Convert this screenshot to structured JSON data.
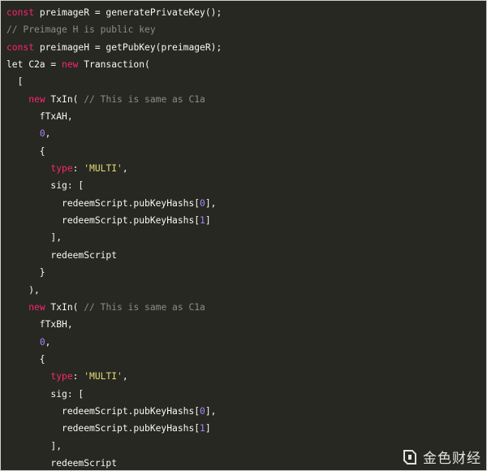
{
  "code": {
    "lines": [
      [
        {
          "t": "keyword",
          "v": "const"
        },
        {
          "t": "plain",
          "v": " preimageR = generatePrivateKey();"
        }
      ],
      [
        {
          "t": "comment",
          "v": "// Preimage H is public key"
        }
      ],
      [
        {
          "t": "keyword",
          "v": "const"
        },
        {
          "t": "plain",
          "v": " preimageH = getPubKey(preimageR);"
        }
      ],
      [
        {
          "t": "plain",
          "v": "let C2a = "
        },
        {
          "t": "keyword",
          "v": "new"
        },
        {
          "t": "plain",
          "v": " Transaction("
        }
      ],
      [
        {
          "t": "plain",
          "v": "  ["
        }
      ],
      [
        {
          "t": "plain",
          "v": "    "
        },
        {
          "t": "keyword",
          "v": "new"
        },
        {
          "t": "plain",
          "v": " TxIn( "
        },
        {
          "t": "comment",
          "v": "// This is same as C1a"
        }
      ],
      [
        {
          "t": "plain",
          "v": "      fTxAH,"
        }
      ],
      [
        {
          "t": "plain",
          "v": "      "
        },
        {
          "t": "number",
          "v": "0"
        },
        {
          "t": "plain",
          "v": ","
        }
      ],
      [
        {
          "t": "plain",
          "v": "      {"
        }
      ],
      [
        {
          "t": "plain",
          "v": "        "
        },
        {
          "t": "keyword",
          "v": "type"
        },
        {
          "t": "plain",
          "v": ": "
        },
        {
          "t": "string",
          "v": "'MULTI'"
        },
        {
          "t": "plain",
          "v": ","
        }
      ],
      [
        {
          "t": "plain",
          "v": "        sig: ["
        }
      ],
      [
        {
          "t": "plain",
          "v": "          redeemScript.pubKeyHashs["
        },
        {
          "t": "number",
          "v": "0"
        },
        {
          "t": "plain",
          "v": "],"
        }
      ],
      [
        {
          "t": "plain",
          "v": "          redeemScript.pubKeyHashs["
        },
        {
          "t": "number",
          "v": "1"
        },
        {
          "t": "plain",
          "v": "]"
        }
      ],
      [
        {
          "t": "plain",
          "v": "        ],"
        }
      ],
      [
        {
          "t": "plain",
          "v": "        redeemScript"
        }
      ],
      [
        {
          "t": "plain",
          "v": "      }"
        }
      ],
      [
        {
          "t": "plain",
          "v": "    ),"
        }
      ],
      [
        {
          "t": "plain",
          "v": "    "
        },
        {
          "t": "keyword",
          "v": "new"
        },
        {
          "t": "plain",
          "v": " TxIn( "
        },
        {
          "t": "comment",
          "v": "// This is same as C1a"
        }
      ],
      [
        {
          "t": "plain",
          "v": "      fTxBH,"
        }
      ],
      [
        {
          "t": "plain",
          "v": "      "
        },
        {
          "t": "number",
          "v": "0"
        },
        {
          "t": "plain",
          "v": ","
        }
      ],
      [
        {
          "t": "plain",
          "v": "      {"
        }
      ],
      [
        {
          "t": "plain",
          "v": "        "
        },
        {
          "t": "keyword",
          "v": "type"
        },
        {
          "t": "plain",
          "v": ": "
        },
        {
          "t": "string",
          "v": "'MULTI'"
        },
        {
          "t": "plain",
          "v": ","
        }
      ],
      [
        {
          "t": "plain",
          "v": "        sig: ["
        }
      ],
      [
        {
          "t": "plain",
          "v": "          redeemScript.pubKeyHashs["
        },
        {
          "t": "number",
          "v": "0"
        },
        {
          "t": "plain",
          "v": "],"
        }
      ],
      [
        {
          "t": "plain",
          "v": "          redeemScript.pubKeyHashs["
        },
        {
          "t": "number",
          "v": "1"
        },
        {
          "t": "plain",
          "v": "]"
        }
      ],
      [
        {
          "t": "plain",
          "v": "        ],"
        }
      ],
      [
        {
          "t": "plain",
          "v": "        redeemScript"
        }
      ]
    ]
  },
  "theme": {
    "background": "#272822",
    "keyword": "#f92672",
    "comment": "#8b8e83",
    "number": "#ae81ff",
    "string": "#e6db74",
    "text": "#f8f8f2"
  },
  "watermark": {
    "icon": "jinse-logo-icon",
    "text": "金色财经"
  }
}
